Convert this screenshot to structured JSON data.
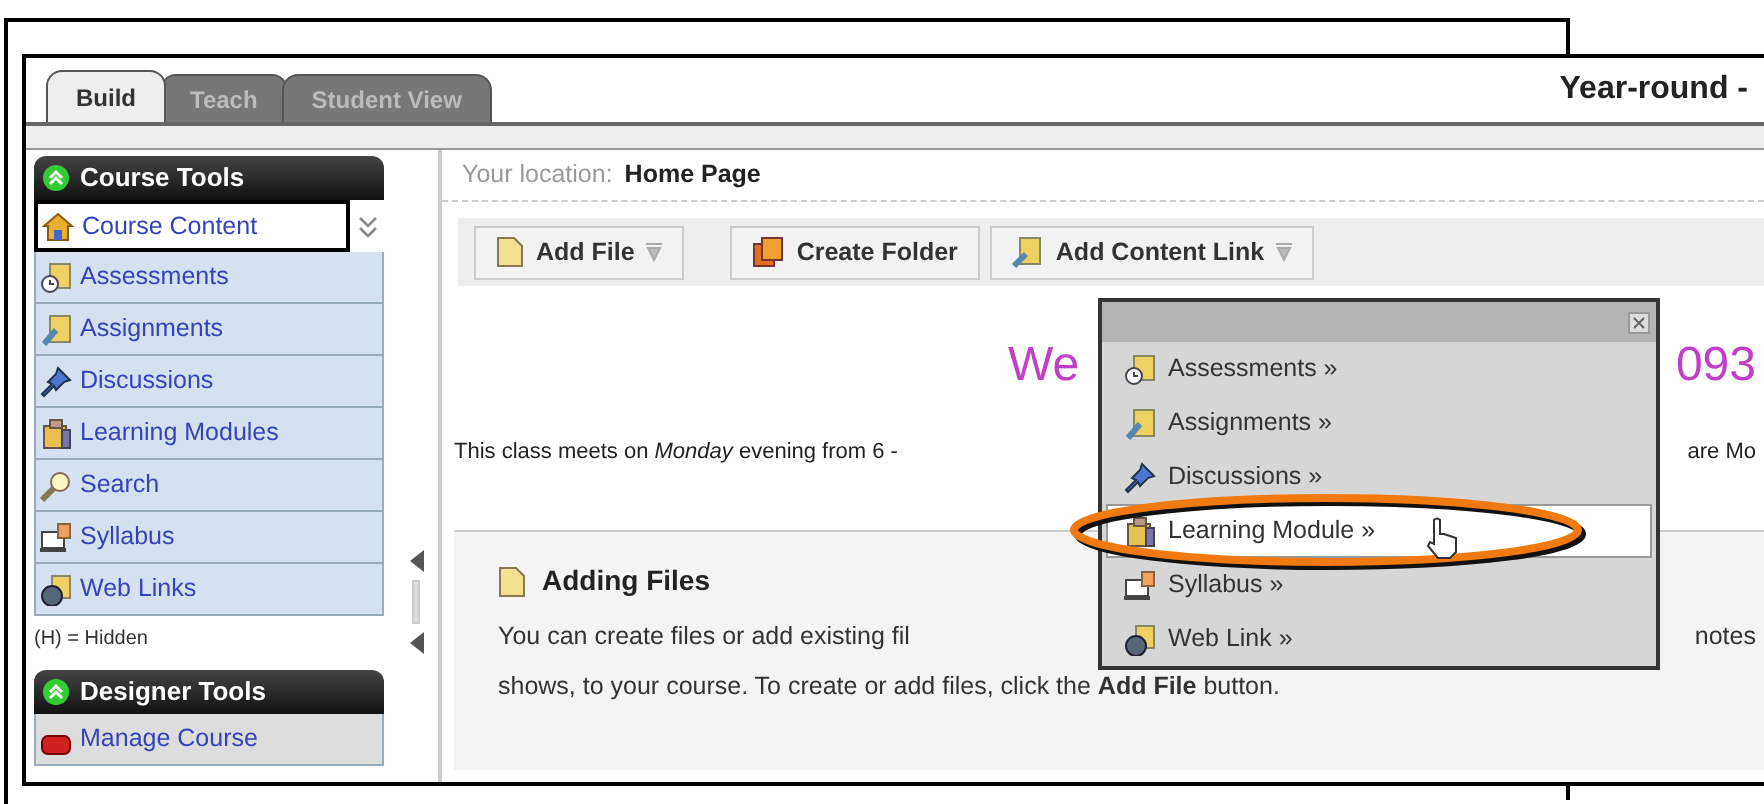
{
  "tabs": [
    {
      "label": "Build",
      "selected": true
    },
    {
      "label": "Teach",
      "selected": false
    },
    {
      "label": "Student View",
      "selected": false
    }
  ],
  "course_title": "Year-round -",
  "sidebar": {
    "sections": [
      {
        "title": "Course Tools",
        "legend": "(H) = Hidden",
        "items": [
          {
            "label": "Course Content",
            "selected": true
          },
          {
            "label": "Assessments",
            "selected": false
          },
          {
            "label": "Assignments",
            "selected": false
          },
          {
            "label": "Discussions",
            "selected": false
          },
          {
            "label": "Learning Modules",
            "selected": false
          },
          {
            "label": "Search",
            "selected": false
          },
          {
            "label": "Syllabus",
            "selected": false
          },
          {
            "label": "Web Links",
            "selected": false
          }
        ]
      },
      {
        "title": "Designer Tools",
        "items": [
          {
            "label": "Manage Course",
            "selected": false
          }
        ]
      }
    ]
  },
  "breadcrumb": {
    "label": "Your location:",
    "value": "Home Page"
  },
  "toolbar": [
    {
      "label": "Add File",
      "dropdown": true
    },
    {
      "label": "Create Folder",
      "dropdown": false
    },
    {
      "label": "Add Content Link",
      "dropdown": true
    }
  ],
  "welcome_fragments": [
    "We",
    "093"
  ],
  "schedule_fragments": [
    "This class meets on *Monday* evening from 6 -",
    "are Mo"
  ],
  "info_box": {
    "title": "Adding Files",
    "line_1_fragments": [
      "You can create files or add existing fil",
      "notes"
    ],
    "line_2": "shows, to your course. To create or add files, click the **Add File** button."
  },
  "content_menu": {
    "items": [
      {
        "label": "Assessments »",
        "selected": false
      },
      {
        "label": "Assignments »",
        "selected": false
      },
      {
        "label": "Discussions »",
        "selected": false
      },
      {
        "label": "Learning Module »",
        "selected": true
      },
      {
        "label": "Syllabus »",
        "selected": false
      },
      {
        "label": "Web Link »",
        "selected": false
      }
    ]
  }
}
